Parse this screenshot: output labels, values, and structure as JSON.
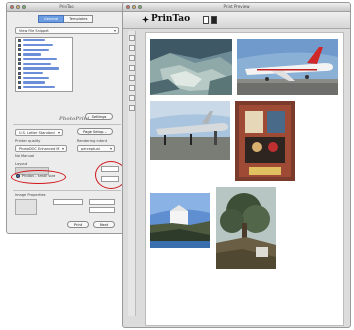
{
  "panel": {
    "title": "PrinTao",
    "tabs": [
      {
        "label": "General",
        "active": true
      },
      {
        "label": "Templates",
        "active": false
      }
    ],
    "source_select": "View File Snippet",
    "settings_button": "Settings",
    "logo": "PhotoPrint",
    "page_setup_button": "Page Setup...",
    "paper_select": "U.S. Letter Standard",
    "printer_label": "Printer quality",
    "rendering_label": "Rendering intent",
    "color_select": "PhotoDOC Enhanced M",
    "intent_select": "perceptual",
    "no_manual": "No Manual",
    "layout_label": "Layout",
    "radio_label": "Photos - small size",
    "image_props": "Image Properties",
    "print_button": "Print",
    "next_button": "Next",
    "accent": "#d0181e"
  },
  "preview": {
    "title": "Print Preview",
    "brand": "PrinTao"
  }
}
